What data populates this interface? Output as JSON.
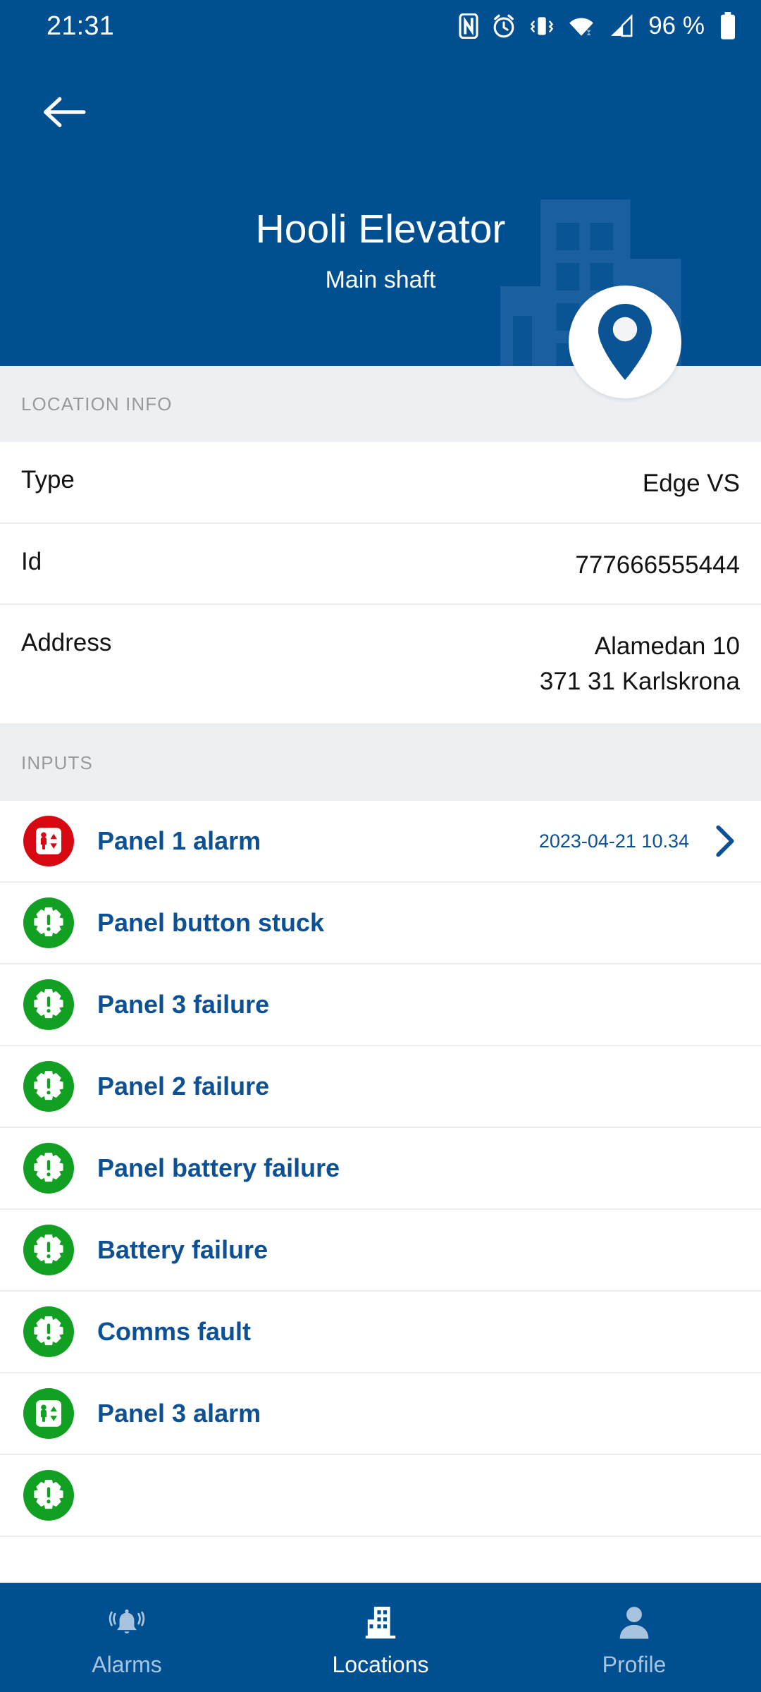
{
  "status_bar": {
    "time": "21:31",
    "battery_percent": "96 %",
    "icons": [
      "nfc-icon",
      "alarm-clock-icon",
      "vibrate-icon",
      "wifi-icon",
      "cellular-signal-icon",
      "battery-icon"
    ]
  },
  "header": {
    "back_label": "back-arrow",
    "title": "Hooli Elevator",
    "subtitle": "Main shaft",
    "background_color": "#004F91",
    "watermark": "building-watermark",
    "badge_icon": "location-pin-icon"
  },
  "location_info": {
    "section_label": "LOCATION INFO",
    "rows": [
      {
        "label": "Type",
        "value": "Edge VS"
      },
      {
        "label": "Id",
        "value": "777666555444"
      },
      {
        "label": "Address",
        "value_line1": "Alamedan 10",
        "value_line2": "371 31 Karlskrona"
      }
    ]
  },
  "inputs": {
    "section_label": "INPUTS",
    "items": [
      {
        "label": "Panel 1 alarm",
        "status": "alarm",
        "status_color": "#D60812",
        "icon": "elevator-icon",
        "timestamp": "2023-04-21 10.34",
        "chevron": true
      },
      {
        "label": "Panel button stuck",
        "status": "ok",
        "status_color": "#12A023",
        "icon": "gear-alert-icon",
        "timestamp": "",
        "chevron": false
      },
      {
        "label": "Panel 3 failure",
        "status": "ok",
        "status_color": "#12A023",
        "icon": "gear-alert-icon",
        "timestamp": "",
        "chevron": false
      },
      {
        "label": "Panel 2 failure",
        "status": "ok",
        "status_color": "#12A023",
        "icon": "gear-alert-icon",
        "timestamp": "",
        "chevron": false
      },
      {
        "label": "Panel battery failure",
        "status": "ok",
        "status_color": "#12A023",
        "icon": "gear-alert-icon",
        "timestamp": "",
        "chevron": false
      },
      {
        "label": "Battery failure",
        "status": "ok",
        "status_color": "#12A023",
        "icon": "gear-alert-icon",
        "timestamp": "",
        "chevron": false
      },
      {
        "label": "Comms fault",
        "status": "ok",
        "status_color": "#12A023",
        "icon": "gear-alert-icon",
        "timestamp": "",
        "chevron": false
      },
      {
        "label": "Panel 3 alarm",
        "status": "ok",
        "status_color": "#12A023",
        "icon": "elevator-icon",
        "timestamp": "",
        "chevron": false
      },
      {
        "label": "",
        "status": "ok",
        "status_color": "#12A023",
        "icon": "gear-alert-icon",
        "timestamp": "",
        "chevron": false
      }
    ]
  },
  "bottom_nav": {
    "items": [
      {
        "label": "Alarms",
        "icon": "alarm-bell-icon",
        "active": false
      },
      {
        "label": "Locations",
        "icon": "building-icon",
        "active": true
      },
      {
        "label": "Profile",
        "icon": "person-icon",
        "active": false
      }
    ]
  }
}
